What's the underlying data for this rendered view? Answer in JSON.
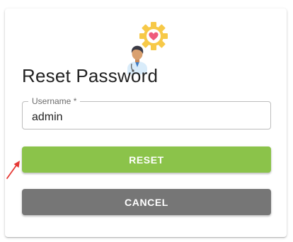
{
  "form": {
    "title": "Reset Password",
    "username_label": "Username *",
    "username_value": "admin",
    "reset_label": "RESET",
    "cancel_label": "CANCEL"
  },
  "colors": {
    "reset_button": "#8bc34a",
    "cancel_button": "#767676",
    "pointer_arrow": "#e53935"
  },
  "icons": {
    "logo": "doctor-with-gear-heart-icon",
    "pointer": "red-arrow-icon"
  }
}
